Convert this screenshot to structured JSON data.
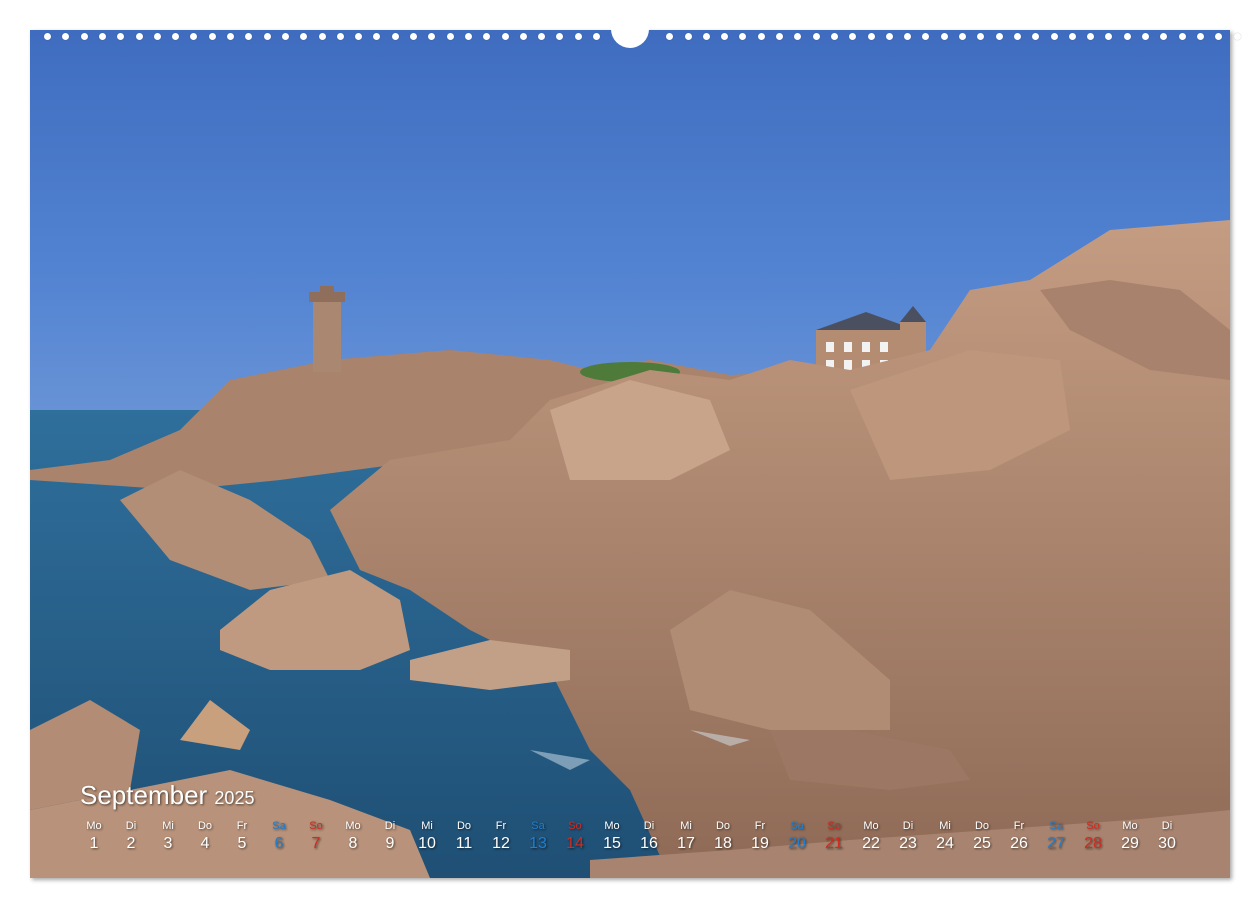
{
  "calendar": {
    "month": "September",
    "year": "2025",
    "days": [
      {
        "wd": "Mo",
        "n": "1",
        "type": "weekday"
      },
      {
        "wd": "Di",
        "n": "2",
        "type": "weekday"
      },
      {
        "wd": "Mi",
        "n": "3",
        "type": "weekday"
      },
      {
        "wd": "Do",
        "n": "4",
        "type": "weekday"
      },
      {
        "wd": "Fr",
        "n": "5",
        "type": "weekday"
      },
      {
        "wd": "Sa",
        "n": "6",
        "type": "sat"
      },
      {
        "wd": "So",
        "n": "7",
        "type": "sun"
      },
      {
        "wd": "Mo",
        "n": "8",
        "type": "weekday"
      },
      {
        "wd": "Di",
        "n": "9",
        "type": "weekday"
      },
      {
        "wd": "Mi",
        "n": "10",
        "type": "weekday"
      },
      {
        "wd": "Do",
        "n": "11",
        "type": "weekday"
      },
      {
        "wd": "Fr",
        "n": "12",
        "type": "weekday"
      },
      {
        "wd": "Sa",
        "n": "13",
        "type": "sat"
      },
      {
        "wd": "So",
        "n": "14",
        "type": "sun"
      },
      {
        "wd": "Mo",
        "n": "15",
        "type": "weekday"
      },
      {
        "wd": "Di",
        "n": "16",
        "type": "weekday"
      },
      {
        "wd": "Mi",
        "n": "17",
        "type": "weekday"
      },
      {
        "wd": "Do",
        "n": "18",
        "type": "weekday"
      },
      {
        "wd": "Fr",
        "n": "19",
        "type": "weekday"
      },
      {
        "wd": "Sa",
        "n": "20",
        "type": "sat"
      },
      {
        "wd": "So",
        "n": "21",
        "type": "sun"
      },
      {
        "wd": "Mo",
        "n": "22",
        "type": "weekday"
      },
      {
        "wd": "Di",
        "n": "23",
        "type": "weekday"
      },
      {
        "wd": "Mi",
        "n": "24",
        "type": "weekday"
      },
      {
        "wd": "Do",
        "n": "25",
        "type": "weekday"
      },
      {
        "wd": "Fr",
        "n": "26",
        "type": "weekday"
      },
      {
        "wd": "Sa",
        "n": "27",
        "type": "sat"
      },
      {
        "wd": "So",
        "n": "28",
        "type": "sun"
      },
      {
        "wd": "Mo",
        "n": "29",
        "type": "weekday"
      },
      {
        "wd": "Di",
        "n": "30",
        "type": "weekday"
      }
    ]
  },
  "photo": {
    "subject": "rocky-coast-lighthouse-photo",
    "colors": {
      "sky": "#4a78c8",
      "sea": "#2c6a96",
      "rock": "#b08a70"
    }
  },
  "colors": {
    "saturday": "#1f7fd0",
    "sunday": "#d42a20",
    "text": "#ffffff"
  }
}
